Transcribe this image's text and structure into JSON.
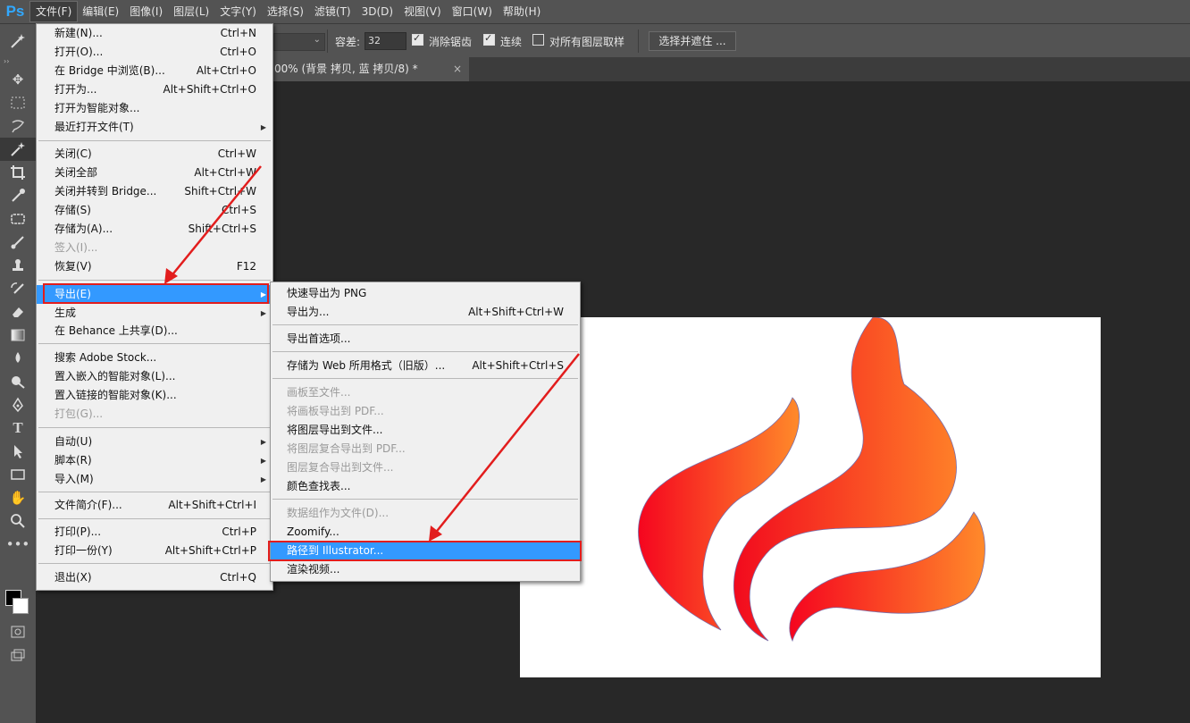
{
  "app": {
    "logo": "Ps"
  },
  "menubar": {
    "items": [
      "文件(F)",
      "编辑(E)",
      "图像(I)",
      "图层(L)",
      "文字(Y)",
      "选择(S)",
      "滤镜(T)",
      "3D(D)",
      "视图(V)",
      "窗口(W)",
      "帮助(H)"
    ],
    "active": "文件(F)"
  },
  "options": {
    "tolerance_label": "容差:",
    "tolerance_value": "32",
    "antialias_label": "消除锯齿",
    "antialias_checked": true,
    "contiguous_label": "连续",
    "contiguous_checked": true,
    "all_layers_label": "对所有图层取样",
    "all_layers_checked": false,
    "select_mask_button": "选择并遮住 ..."
  },
  "document": {
    "tab_title": "00% (背景 拷贝, 蓝 拷贝/8) *",
    "tab_close": "×"
  },
  "file_menu": {
    "items": [
      {
        "label": "新建(N)...",
        "shortcut": "Ctrl+N"
      },
      {
        "label": "打开(O)...",
        "shortcut": "Ctrl+O"
      },
      {
        "label": "在 Bridge 中浏览(B)...",
        "shortcut": "Alt+Ctrl+O"
      },
      {
        "label": "打开为...",
        "shortcut": "Alt+Shift+Ctrl+O"
      },
      {
        "label": "打开为智能对象...",
        "shortcut": ""
      },
      {
        "label": "最近打开文件(T)",
        "shortcut": "",
        "submenu": true
      },
      {
        "label": "关闭(C)",
        "shortcut": "Ctrl+W"
      },
      {
        "label": "关闭全部",
        "shortcut": "Alt+Ctrl+W"
      },
      {
        "label": "关闭并转到 Bridge...",
        "shortcut": "Shift+Ctrl+W"
      },
      {
        "label": "存储(S)",
        "shortcut": "Ctrl+S"
      },
      {
        "label": "存储为(A)...",
        "shortcut": "Shift+Ctrl+S"
      },
      {
        "label": "签入(I)...",
        "shortcut": "",
        "disabled": true
      },
      {
        "label": "恢复(V)",
        "shortcut": "F12"
      },
      {
        "label": "导出(E)",
        "shortcut": "",
        "submenu": true,
        "highlighted": true
      },
      {
        "label": "生成",
        "shortcut": "",
        "submenu": true
      },
      {
        "label": "在 Behance 上共享(D)...",
        "shortcut": ""
      },
      {
        "label": "搜索 Adobe Stock...",
        "shortcut": ""
      },
      {
        "label": "置入嵌入的智能对象(L)...",
        "shortcut": ""
      },
      {
        "label": "置入链接的智能对象(K)...",
        "shortcut": ""
      },
      {
        "label": "打包(G)...",
        "shortcut": "",
        "disabled": true
      },
      {
        "label": "自动(U)",
        "shortcut": "",
        "submenu": true
      },
      {
        "label": "脚本(R)",
        "shortcut": "",
        "submenu": true
      },
      {
        "label": "导入(M)",
        "shortcut": "",
        "submenu": true
      },
      {
        "label": "文件简介(F)...",
        "shortcut": "Alt+Shift+Ctrl+I"
      },
      {
        "label": "打印(P)...",
        "shortcut": "Ctrl+P"
      },
      {
        "label": "打印一份(Y)",
        "shortcut": "Alt+Shift+Ctrl+P"
      },
      {
        "label": "退出(X)",
        "shortcut": "Ctrl+Q"
      }
    ]
  },
  "export_menu": {
    "items": [
      {
        "label": "快速导出为 PNG",
        "shortcut": ""
      },
      {
        "label": "导出为...",
        "shortcut": "Alt+Shift+Ctrl+W"
      },
      {
        "label": "导出首选项...",
        "shortcut": ""
      },
      {
        "label": "存储为 Web 所用格式（旧版）...",
        "shortcut": "Alt+Shift+Ctrl+S"
      },
      {
        "label": "画板至文件...",
        "shortcut": "",
        "disabled": true
      },
      {
        "label": "将画板导出到 PDF...",
        "shortcut": "",
        "disabled": true
      },
      {
        "label": "将图层导出到文件...",
        "shortcut": ""
      },
      {
        "label": "将图层复合导出到 PDF...",
        "shortcut": "",
        "disabled": true
      },
      {
        "label": "图层复合导出到文件...",
        "shortcut": "",
        "disabled": true
      },
      {
        "label": "颜色查找表...",
        "shortcut": ""
      },
      {
        "label": "数据组作为文件(D)...",
        "shortcut": "",
        "disabled": true
      },
      {
        "label": "Zoomify...",
        "shortcut": ""
      },
      {
        "label": "路径到 Illustrator...",
        "shortcut": "",
        "highlighted": true
      },
      {
        "label": "渲染视频...",
        "shortcut": ""
      }
    ]
  },
  "colors": {
    "highlight": "#3399ff",
    "annotation_red": "#e21d1d",
    "flame_start": "#f5051f",
    "flame_end": "#ff8a2a"
  }
}
